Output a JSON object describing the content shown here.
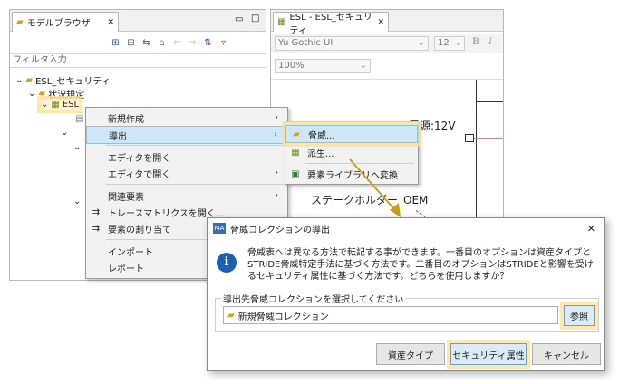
{
  "left_panel": {
    "tab_title": "モデルブラウザ",
    "filter_placeholder": "フィルタ入力",
    "tree": {
      "root": "ESL_セキュリティ",
      "child": "状況規定",
      "leaf": "ESL"
    }
  },
  "right_panel": {
    "tab_title": "ESL - ESL_セキュリティ",
    "font_name": "Yu Gothic UI",
    "font_size": "12",
    "bold": "B",
    "italic": "I",
    "zoom": "100%",
    "canvas": {
      "power_label": "電源:12V",
      "stakeholder_label": "ステークホルダー_OEM"
    }
  },
  "context_menu": {
    "items": [
      {
        "label": "新規作成",
        "submenu": true
      },
      {
        "label": "導出",
        "submenu": true
      },
      {
        "label": "エディタを開く",
        "submenu": false
      },
      {
        "label": "エディタで開く",
        "submenu": true
      },
      {
        "label": "関連要素",
        "submenu": true
      },
      {
        "label": "トレースマトリクスを開く...",
        "submenu": false
      },
      {
        "label": "要素の割り当て",
        "submenu": false
      },
      {
        "label": "インポート",
        "submenu": true
      },
      {
        "label": "レポート",
        "submenu": true
      }
    ]
  },
  "submenu": {
    "items": [
      {
        "label": "脅威..."
      },
      {
        "label": "派生..."
      },
      {
        "label": "要素ライブラリへ変換"
      }
    ]
  },
  "dialog": {
    "title": "脅威コレクションの導出",
    "close": "✕",
    "message": "脅威表へは異なる方法で転記する事ができます。一番目のオプションは資産タイプとSTRIDE脅威特定手法に基づく方法です。二番目のオプションはSTRIDEと影響を受けるセキュリティ属性に基づく方法です。どちらを使用しますか？",
    "group_label": "導出先脅威コレクションを選択してください",
    "collection_value": "新規脅威コレクション",
    "browse_button": "参照",
    "buttons": {
      "asset_type": "資産タイプ",
      "security_attribute": "セキュリティ属性",
      "cancel": "キャンセル"
    }
  },
  "colors": {
    "highlight": "#cfe6f7",
    "glow": "#fce296",
    "arrow": "#c8a020",
    "info_blue": "#1a5fb4"
  }
}
